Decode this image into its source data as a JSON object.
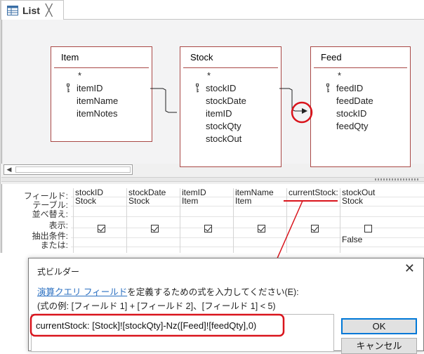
{
  "tab": {
    "label": "List",
    "close": "╳"
  },
  "tables": [
    {
      "name": "Item",
      "fields": [
        {
          "name": "*"
        },
        {
          "name": "itemID",
          "key": true
        },
        {
          "name": "itemName"
        },
        {
          "name": "itemNotes"
        }
      ]
    },
    {
      "name": "Stock",
      "fields": [
        {
          "name": "*"
        },
        {
          "name": "stockID",
          "key": true
        },
        {
          "name": "stockDate"
        },
        {
          "name": "itemID"
        },
        {
          "name": "stockQty"
        },
        {
          "name": "stockOut"
        }
      ]
    },
    {
      "name": "Feed",
      "fields": [
        {
          "name": "*"
        },
        {
          "name": "feedID",
          "key": true
        },
        {
          "name": "feedDate"
        },
        {
          "name": "stockID"
        },
        {
          "name": "feedQty"
        }
      ]
    }
  ],
  "grid": {
    "row_labels": [
      "フィールド:",
      "テーブル:",
      "並べ替え:",
      "表示:",
      "抽出条件:",
      "または:"
    ],
    "columns": [
      {
        "field": "stockID",
        "table": "Stock",
        "show": true,
        "criteria": ""
      },
      {
        "field": "stockDate",
        "table": "Stock",
        "show": true,
        "criteria": ""
      },
      {
        "field": "itemID",
        "table": "Item",
        "show": true,
        "criteria": ""
      },
      {
        "field": "itemName",
        "table": "Item",
        "show": true,
        "criteria": ""
      },
      {
        "field": "currentStock:",
        "table": "",
        "show": true,
        "criteria": ""
      },
      {
        "field": "stockOut",
        "table": "Stock",
        "show": false,
        "criteria": "False"
      }
    ]
  },
  "expression_builder": {
    "title": "式ビルダー",
    "close": "✕",
    "instruction_link": "演算クエリ フィールド",
    "instruction_rest": "を定義するための式を入力してください(E):",
    "example": "(式の例: [フィールド 1] + [フィールド 2]、[フィールド 1] < 5)",
    "expression": "currentStock: [Stock]![stockQty]-Nz([Feed]![feedQty],0)",
    "ok_label": "OK",
    "cancel_label": "キャンセル"
  },
  "colors": {
    "annotation": "#d9141c",
    "table_border": "#a94846",
    "link": "#2a6fc1"
  }
}
